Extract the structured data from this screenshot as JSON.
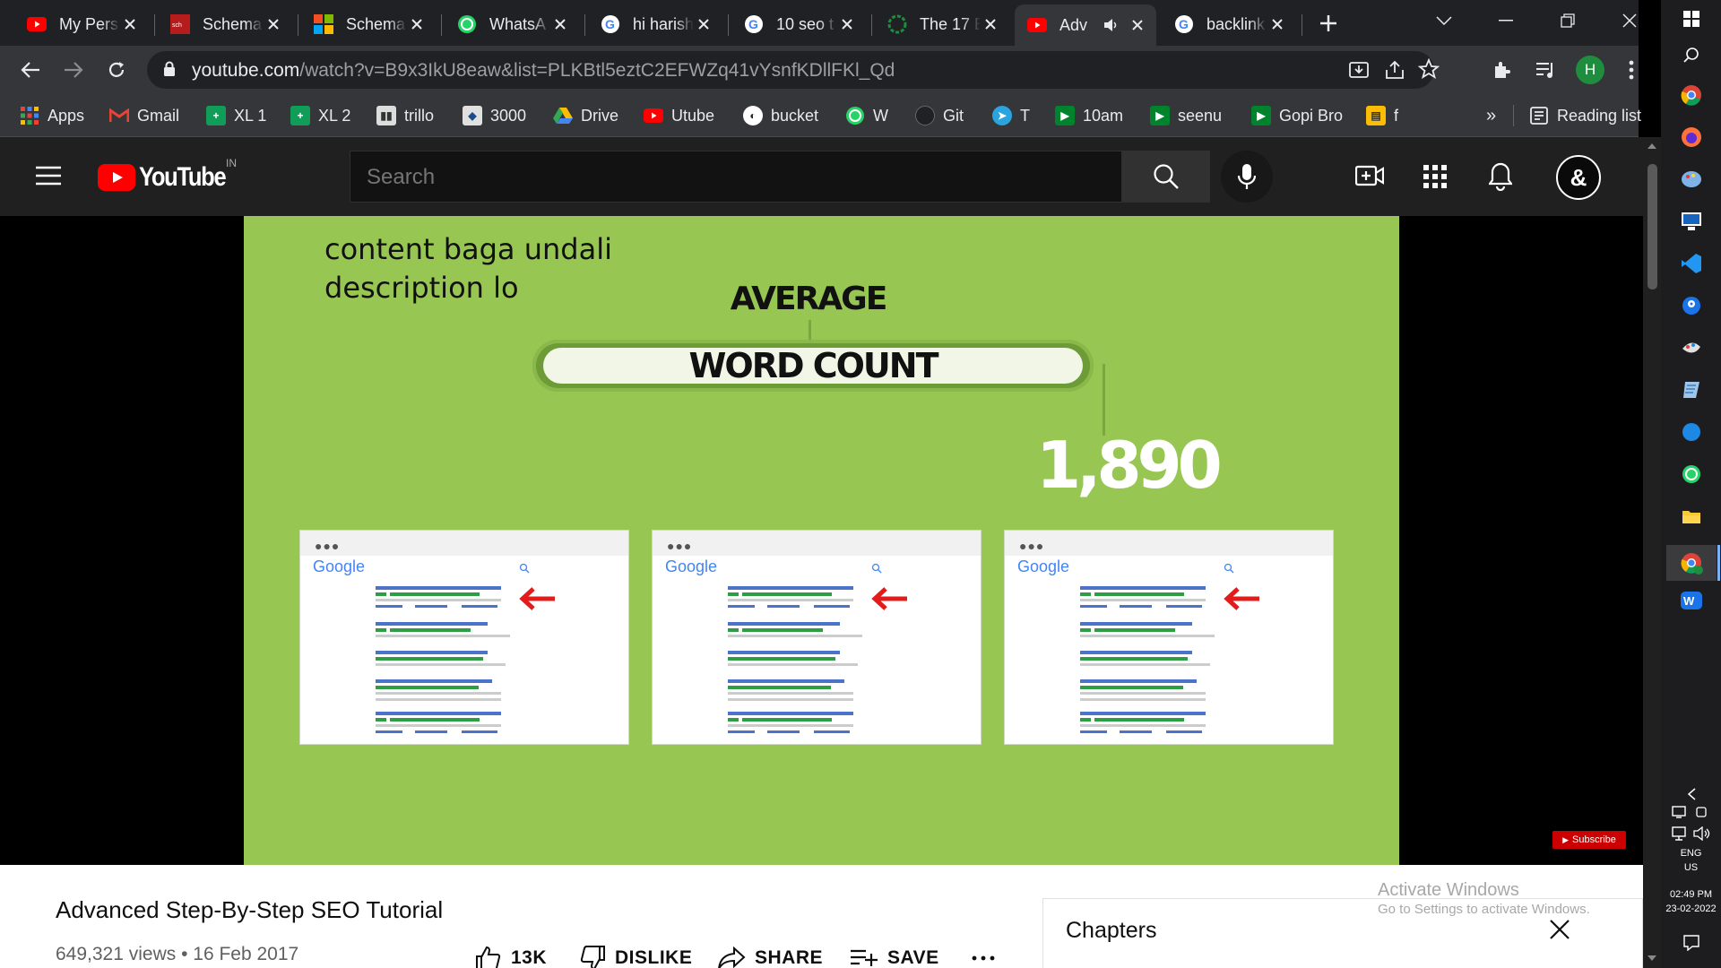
{
  "browser": {
    "tabs": [
      {
        "label": "My Pers",
        "icon": "youtube-icon"
      },
      {
        "label": "Schema",
        "icon": "schema-org-icon"
      },
      {
        "label": "Schema",
        "icon": "microsoft-icon"
      },
      {
        "label": "WhatsA",
        "icon": "whatsapp-icon"
      },
      {
        "label": "hi harish",
        "icon": "google-icon"
      },
      {
        "label": "10 seo t",
        "icon": "google-icon"
      },
      {
        "label": "The 17 B",
        "icon": "loading-icon"
      },
      {
        "label": "Adv",
        "icon": "youtube-icon",
        "active": true
      },
      {
        "label": "backlink",
        "icon": "google-icon"
      }
    ],
    "url_domain": "youtube.com",
    "url_path": "/watch?v=B9x3IkU8eaw&list=PLKBtl5eztC2EFWZq41vYsnfKDllFKl_Qd",
    "profile_initial": "H",
    "bookmarks": [
      {
        "label": "Apps",
        "icon": "apps-grid-icon"
      },
      {
        "label": "Gmail",
        "icon": "gmail-icon"
      },
      {
        "label": "XL 1",
        "icon": "sheets-icon"
      },
      {
        "label": "XL 2",
        "icon": "sheets-icon"
      },
      {
        "label": "trillo",
        "icon": "trello-icon"
      },
      {
        "label": "3000",
        "icon": "bookmark-3000-icon"
      },
      {
        "label": "Drive",
        "icon": "drive-icon"
      },
      {
        "label": "Utube",
        "icon": "youtube-icon"
      },
      {
        "label": "bucket",
        "icon": "bucket-icon"
      },
      {
        "label": "W",
        "icon": "whatsapp-icon"
      },
      {
        "label": "Git",
        "icon": "github-icon"
      },
      {
        "label": "T",
        "icon": "telegram-icon"
      },
      {
        "label": "10am",
        "icon": "meet-icon"
      },
      {
        "label": "seenu",
        "icon": "meet-icon"
      },
      {
        "label": "Gopi Bro",
        "icon": "meet-icon"
      },
      {
        "label": "f",
        "icon": "folder-icon"
      }
    ],
    "reading_list": "Reading list"
  },
  "youtube": {
    "logo_text": "YouTube",
    "region": "IN",
    "search_placeholder": "Search",
    "video": {
      "overlay_text_line1": "content baga undali",
      "overlay_text_line2": "description lo",
      "heading_top": "AVERAGE",
      "heading_bar": "WORD COUNT",
      "count": "1,890",
      "serp_logo": "Google",
      "subscribe_label": "Subscribe"
    },
    "title": "Advanced Step-By-Step SEO Tutorial",
    "meta": "649,321 views • 16 Feb 2017",
    "actions": {
      "like": "13K",
      "dislike": "DISLIKE",
      "share": "SHARE",
      "save": "SAVE"
    },
    "chapters_title": "Chapters"
  },
  "windows": {
    "activate_title": "Activate Windows",
    "activate_sub": "Go to Settings to activate Windows.",
    "lang_line1": "ENG",
    "lang_line2": "US",
    "time": "02:49 PM",
    "date": "23-02-2022"
  },
  "colors": {
    "video_bg": "#97c653",
    "yt_red": "#ff0000",
    "accent_blue": "#1a73e8"
  }
}
